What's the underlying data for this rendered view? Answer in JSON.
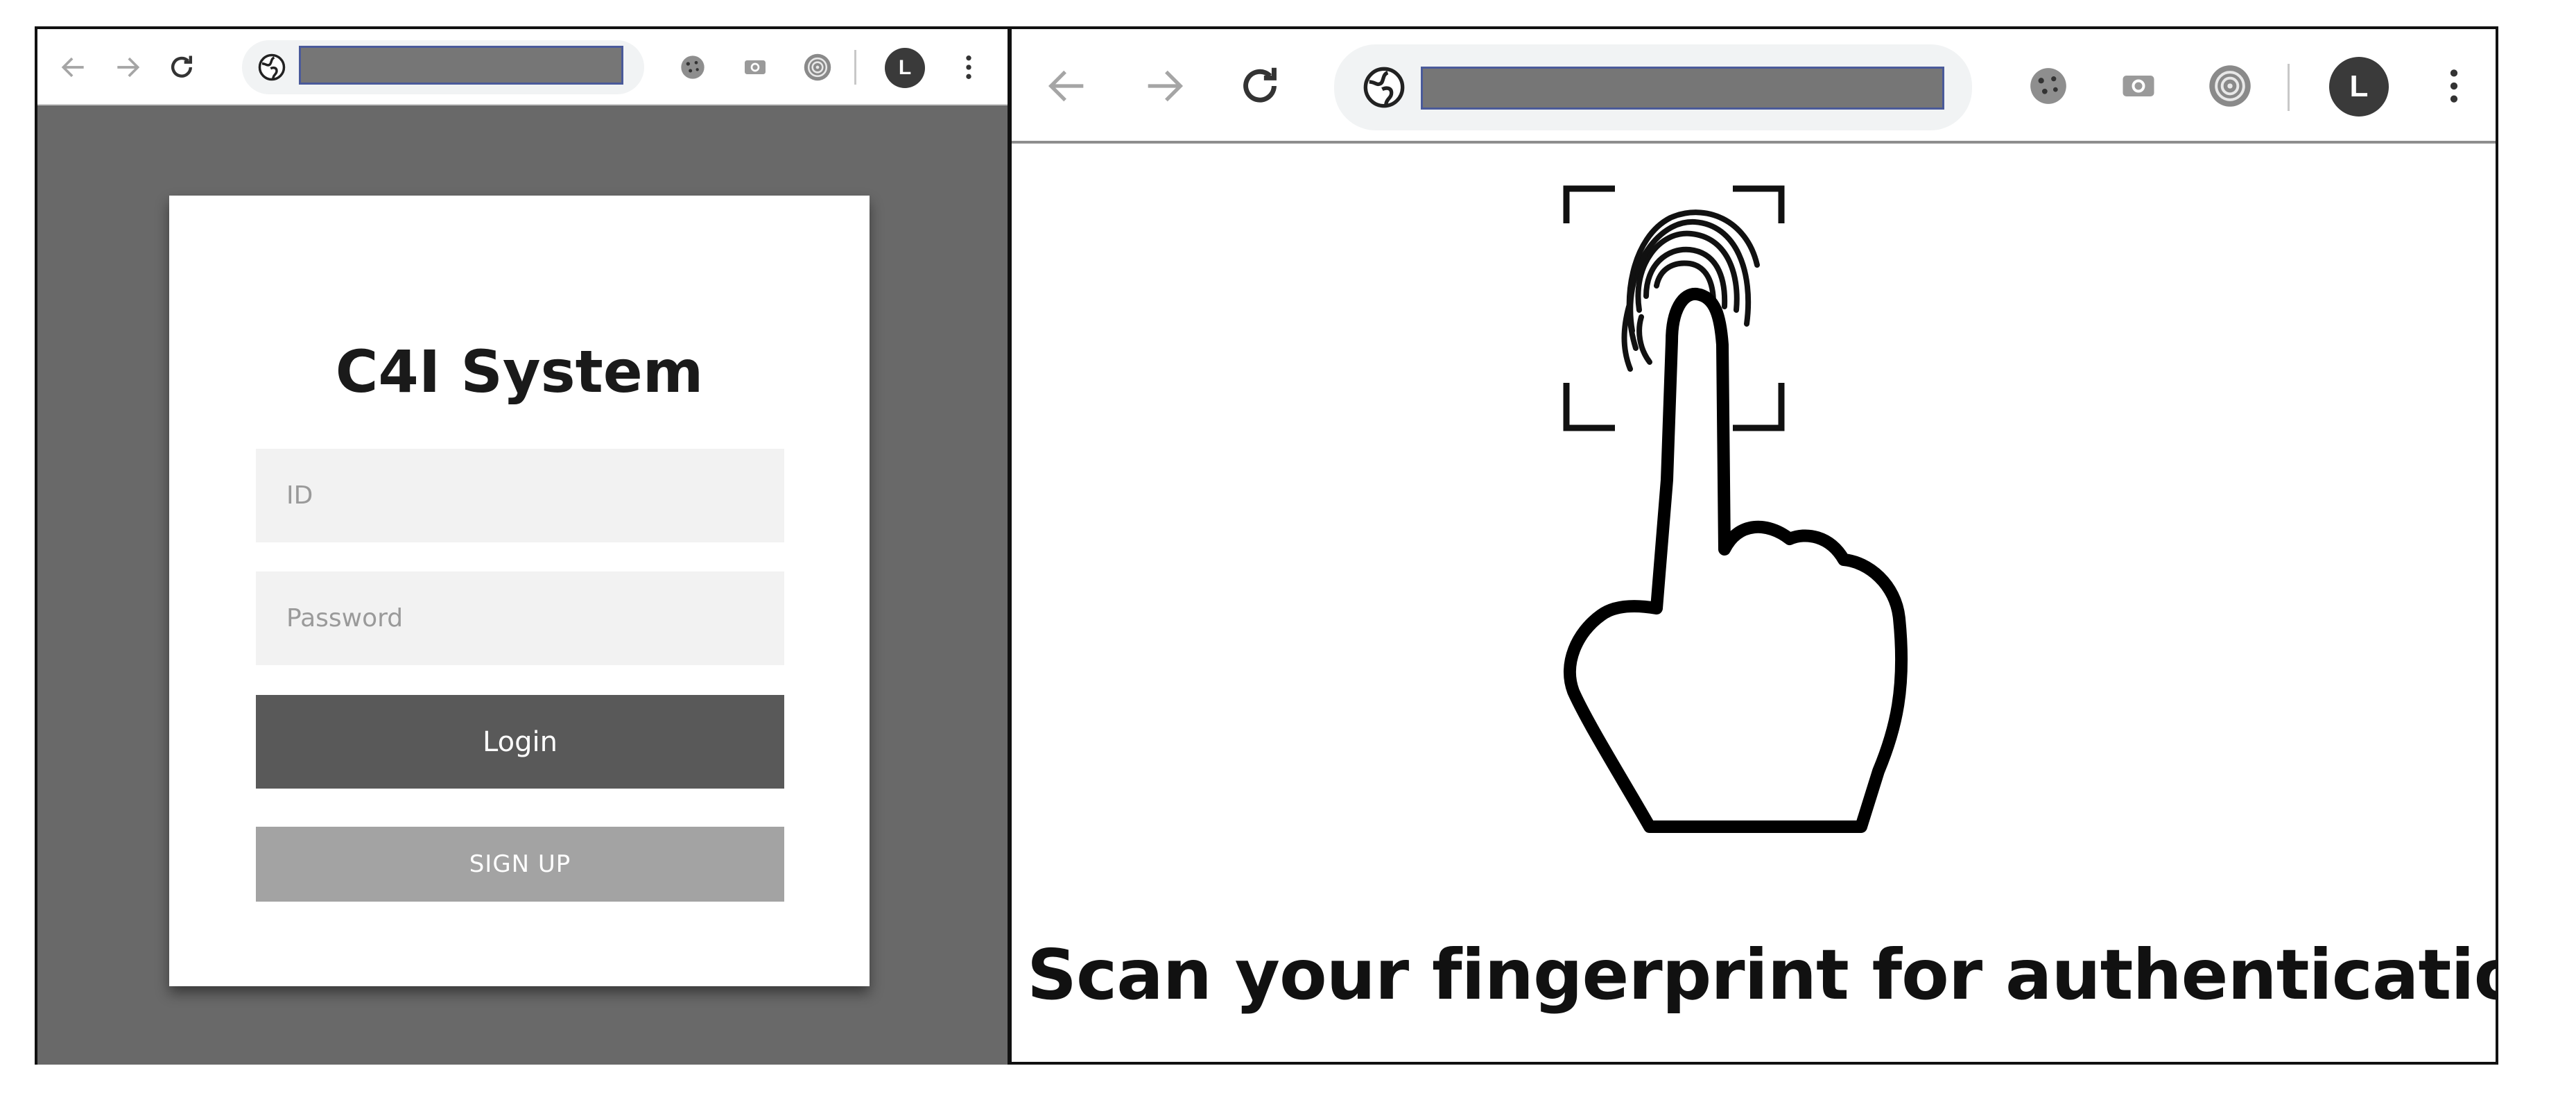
{
  "left_window": {
    "toolbar": {
      "back_icon": "arrow-left-icon",
      "forward_icon": "arrow-right-icon",
      "reload_icon": "reload-icon",
      "site_icon": "globe-icon",
      "extension_icons": [
        "cookie-icon",
        "screenshot-icon",
        "fingerprint-icon"
      ],
      "avatar_letter": "L",
      "menu_icon": "kebab-menu-icon"
    },
    "login": {
      "title": "C4I System",
      "id_placeholder": "ID",
      "password_placeholder": "Password",
      "login_label": "Login",
      "signup_label": "SIGN UP"
    }
  },
  "right_window": {
    "toolbar": {
      "back_icon": "arrow-left-icon",
      "forward_icon": "arrow-right-icon",
      "reload_icon": "reload-icon",
      "site_icon": "globe-icon",
      "extension_icons": [
        "cookie-icon",
        "screenshot-icon",
        "fingerprint-icon"
      ],
      "avatar_letter": "L",
      "menu_icon": "kebab-menu-icon"
    },
    "message": "Scan your fingerprint for authentication."
  },
  "colors": {
    "overlay_gray": "#696969",
    "login_button": "#595959",
    "signup_button": "#a3a3a3",
    "field_bg": "#f2f2f2",
    "url_redacted": "#767676"
  }
}
